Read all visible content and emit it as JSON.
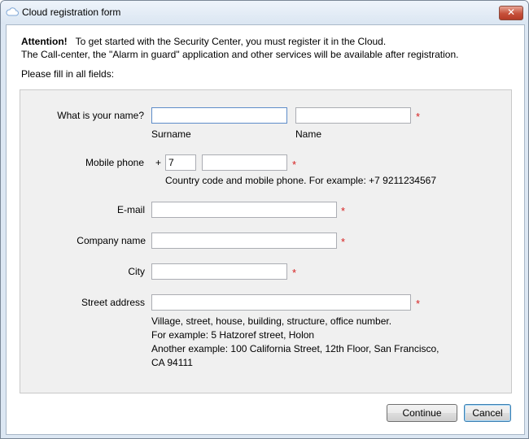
{
  "window": {
    "title": "Cloud registration form",
    "close_label": "✕"
  },
  "intro": {
    "attention": "Attention!",
    "line1": "To get started with the Security Center, you must register it in the Cloud.",
    "line2": "The Call-center, the \"Alarm in guard\" application and other services will be available after registration.",
    "fill_all": "Please fill in all fields:"
  },
  "form": {
    "name_label": "What is your name?",
    "surname_value": "",
    "surname_caption": "Surname",
    "firstname_value": "",
    "firstname_caption": "Name",
    "phone_label": "Mobile phone",
    "phone_plus": "+",
    "phone_country_code": "7",
    "phone_number": "",
    "phone_hint": "Country code and mobile phone. For example: +7 9211234567",
    "email_label": "E-mail",
    "email_value": "",
    "company_label": "Company name",
    "company_value": "",
    "city_label": "City",
    "city_value": "",
    "address_label": "Street address",
    "address_value": "",
    "address_hint_1": "Village, street, house, building, structure, office number.",
    "address_hint_2": "For example: 5 Hatzoref street, Holon",
    "address_hint_3": "Another example: 100 California Street, 12th Floor, San Francisco,",
    "address_hint_4": "CA 94111",
    "required_mark": "*"
  },
  "buttons": {
    "continue": "Continue",
    "cancel": "Cancel"
  },
  "colors": {
    "required": "#d62020",
    "titlebar": "#dbe6f2",
    "panel": "#f0f0f0"
  },
  "icons": {
    "title": "cloud-icon",
    "close": "close-icon"
  }
}
